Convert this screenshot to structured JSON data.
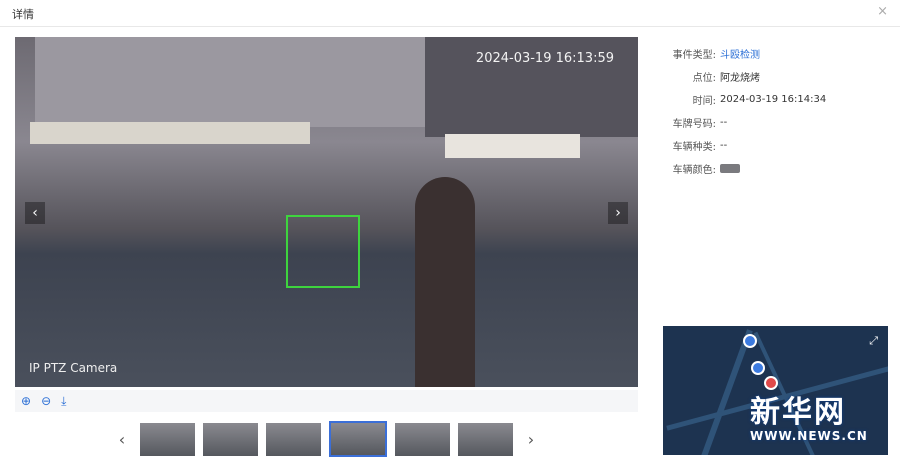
{
  "dialog": {
    "title": "详情",
    "close": "×"
  },
  "video": {
    "timestamp": "2024-03-19 16:13:59",
    "camera_label": "IP PTZ Camera",
    "prev": "‹",
    "next": "›"
  },
  "toolbar": {
    "zoom_in": "⊕",
    "zoom_out": "⊖",
    "download": "⤓"
  },
  "thumbnails": {
    "prev": "‹",
    "next": "›",
    "count": 6,
    "selected_index": 3
  },
  "info": {
    "event_type_label": "事件类型:",
    "event_type": "斗殴检测",
    "location_label": "点位:",
    "location": "阿龙烧烤",
    "time_label": "时间:",
    "time": "2024-03-19 16:14:34",
    "plate_label": "车牌号码:",
    "plate": "--",
    "vehicle_type_label": "车辆种类:",
    "vehicle_type": "--",
    "vehicle_color_label": "车辆颜色:",
    "vehicle_color": "#7a7a7e"
  },
  "map": {
    "expand": "⤢"
  },
  "watermark": {
    "cn": "新华网",
    "url": "WWW.NEWS.CN"
  }
}
